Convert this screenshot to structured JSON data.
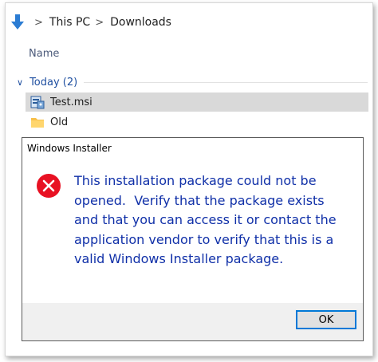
{
  "breadcrumb": {
    "items": [
      "This PC",
      "Downloads"
    ],
    "separator": ">"
  },
  "file_list": {
    "column_header": "Name",
    "group": {
      "label": "Today (2)"
    },
    "files": [
      {
        "name": "Test.msi",
        "icon": "msi-installer-icon",
        "selected": true
      },
      {
        "name": "Old",
        "icon": "folder-icon",
        "selected": false
      }
    ]
  },
  "dialog": {
    "title": "Windows Installer",
    "icon": "error-icon",
    "message_lines": [
      "This installation package could not be",
      "opened.  Verify that the package exists",
      "and that you can access it or contact the",
      "application vendor to verify that this is a",
      "valid Windows Installer package."
    ],
    "ok_label": "OK"
  },
  "colors": {
    "message_text": "#1030a8",
    "error_red": "#e81123",
    "accent": "#0078d7",
    "group_label": "#1f4fa0"
  }
}
